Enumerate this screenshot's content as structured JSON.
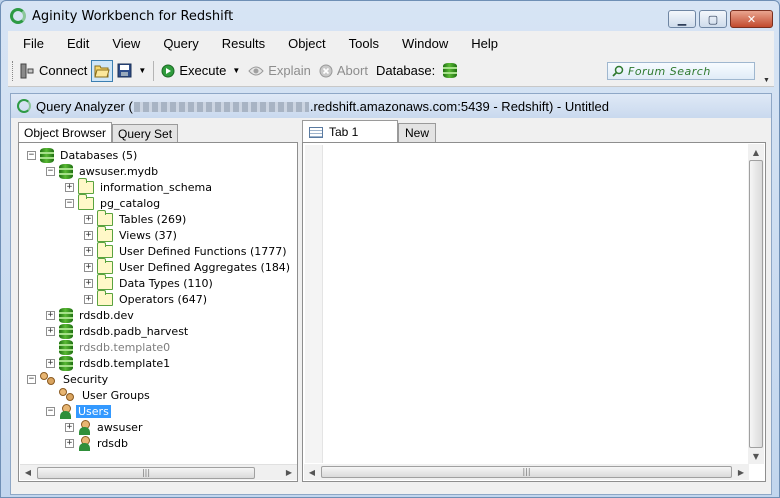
{
  "window": {
    "title": "Aginity Workbench for Redshift"
  },
  "menu": [
    "File",
    "Edit",
    "View",
    "Query",
    "Results",
    "Object",
    "Tools",
    "Window",
    "Help"
  ],
  "toolbar": {
    "connect_label": "Connect",
    "execute_label": "Execute",
    "explain_label": "Explain",
    "abort_label": "Abort",
    "database_label": "Database:",
    "forum_search_label": "Forum Search"
  },
  "document": {
    "title_prefix": "Query Analyzer (",
    "title_suffix": ".redshift.amazonaws.com:5439 - Redshift) - Untitled"
  },
  "left_tabs": [
    "Object Browser",
    "Query Set"
  ],
  "right_tabs": [
    "Tab 1",
    "New"
  ],
  "tree": [
    {
      "label": "Databases (5)"
    },
    {
      "label": "awsuser.mydb"
    },
    {
      "label": "information_schema"
    },
    {
      "label": "pg_catalog"
    },
    {
      "label": "Tables (269)"
    },
    {
      "label": "Views (37)"
    },
    {
      "label": "User Defined Functions (1777)"
    },
    {
      "label": "User Defined Aggregates (184)"
    },
    {
      "label": "Data Types (110)"
    },
    {
      "label": "Operators (647)"
    },
    {
      "label": "rdsdb.dev"
    },
    {
      "label": "rdsdb.padb_harvest"
    },
    {
      "label": "rdsdb.template0"
    },
    {
      "label": "rdsdb.template1"
    },
    {
      "label": "Security"
    },
    {
      "label": "User Groups"
    },
    {
      "label": "Users"
    },
    {
      "label": "awsuser"
    },
    {
      "label": "rdsdb"
    }
  ],
  "colors": {
    "selection": "#3399ff",
    "title_bg": "#c9d9ee",
    "db_icon": "#59b934"
  }
}
